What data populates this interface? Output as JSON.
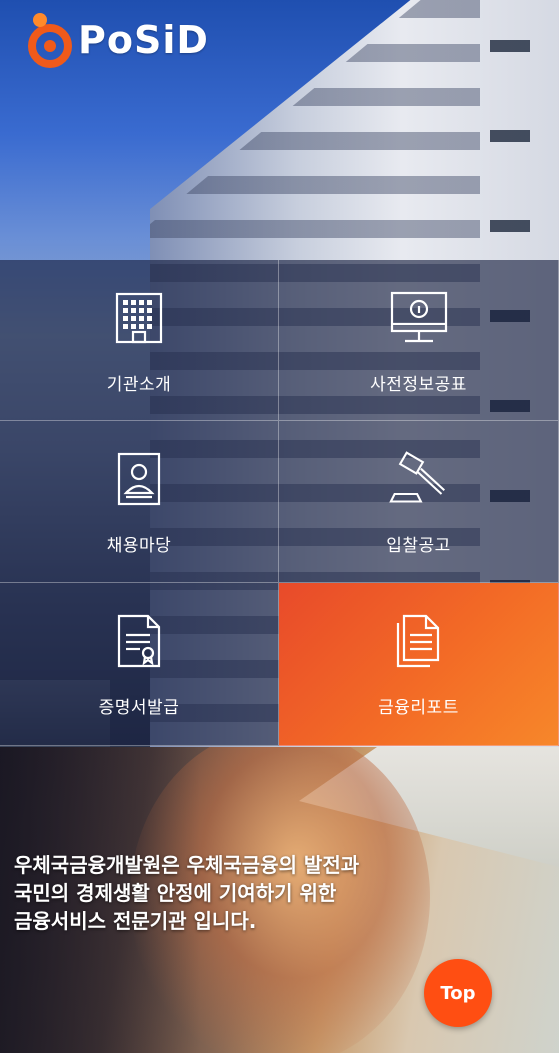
{
  "logo": {
    "text": "PoSiD"
  },
  "menu": {
    "items": [
      {
        "label": "기관소개",
        "icon": "building-icon"
      },
      {
        "label": "사전정보공표",
        "icon": "monitor-info-icon"
      },
      {
        "label": "채용마당",
        "icon": "id-card-icon"
      },
      {
        "label": "입찰공고",
        "icon": "gavel-icon"
      },
      {
        "label": "증명서발급",
        "icon": "certificate-icon"
      },
      {
        "label": "금융리포트",
        "icon": "documents-icon"
      }
    ]
  },
  "tagline": {
    "line1": "우체국금융개발원은 우체국금융의 발전과",
    "line2": "국민의 경제생활 안정에 기여하기 위한",
    "line3": "금융서비스 전문기관 입니다."
  },
  "top_button": {
    "label": "Top"
  },
  "colors": {
    "accent": "#f36b26",
    "top_button": "#ff4e12",
    "logo_orange": "#f05a1a"
  }
}
